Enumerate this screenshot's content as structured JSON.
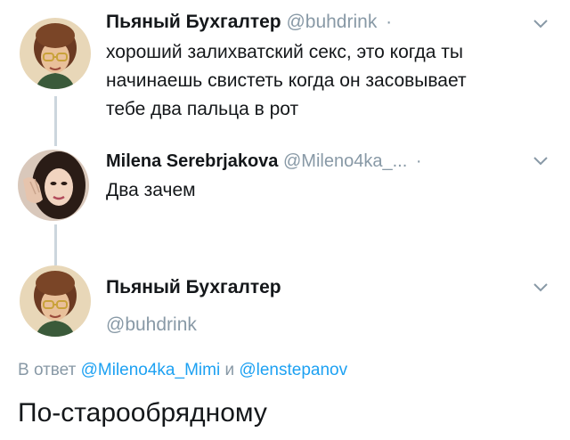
{
  "tweets": [
    {
      "display_name": "Пьяный Бухгалтер",
      "handle": "@buhdrink",
      "separator": "·",
      "text_lines": [
        "хороший залихватский секс, это когда ты",
        "начинаешь свистеть когда он засовывает",
        "тебе два пальца в рот"
      ],
      "avatar_icon": "cartoon-woman-avatar",
      "menu_icon": "chevron-down-icon"
    },
    {
      "display_name": "Milena Serebrjakova",
      "handle": "@Mileno4ka_...",
      "separator": "·",
      "text_lines": [
        "Два зачем"
      ],
      "avatar_icon": "photo-woman-avatar",
      "menu_icon": "chevron-down-icon"
    }
  ],
  "focused_tweet": {
    "display_name": "Пьяный Бухгалтер",
    "handle": "@buhdrink",
    "avatar_icon": "cartoon-woman-avatar",
    "menu_icon": "chevron-down-icon",
    "reply_prefix": "В ответ",
    "reply_mention_1": "@Mileno4ka_Mimi",
    "reply_conjunction": "и",
    "reply_mention_2": "@lenstepanov",
    "text": "По-старообрядному"
  },
  "colors": {
    "mention": "#1da1f2",
    "secondary_text": "#8899a6",
    "thread_line": "#ccd6dd"
  }
}
